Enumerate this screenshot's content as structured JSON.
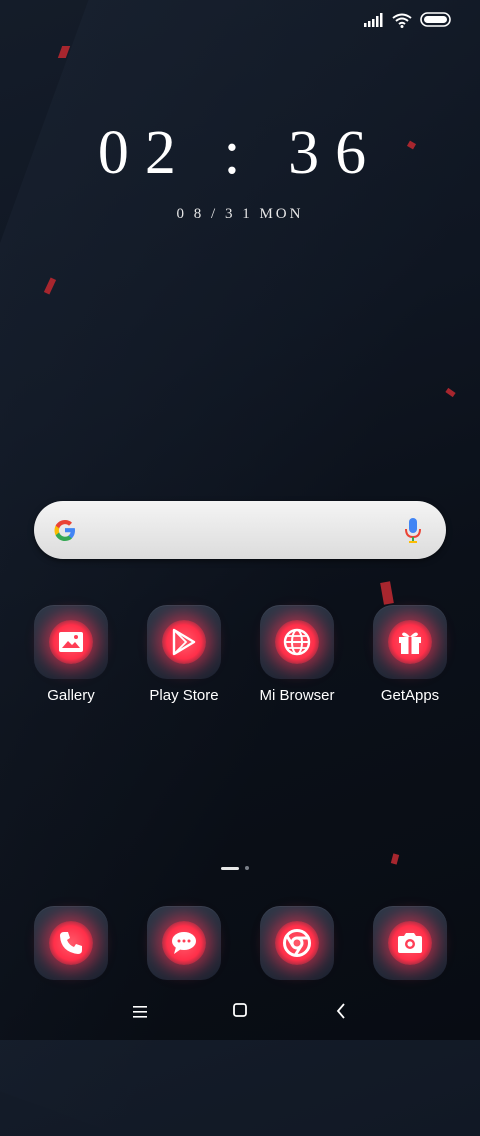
{
  "status_bar": {
    "signal_icon": "signal-bars-icon",
    "wifi_icon": "wifi-icon",
    "battery_icon": "battery-icon"
  },
  "lockclock": {
    "time": "02 : 36",
    "date": "0 8 / 3 1  MON"
  },
  "search_widget": {
    "logo_icon": "google-g-icon",
    "mic_icon": "microphone-icon"
  },
  "apps": [
    {
      "label": "Gallery",
      "icon": "image-icon"
    },
    {
      "label": "Play Store",
      "icon": "play-store-icon"
    },
    {
      "label": "Mi Browser",
      "icon": "globe-icon"
    },
    {
      "label": "GetApps",
      "icon": "gift-icon"
    }
  ],
  "page_indicator": {
    "pages": 2,
    "current": 1
  },
  "dock": [
    {
      "icon": "phone-icon"
    },
    {
      "icon": "message-icon"
    },
    {
      "icon": "chrome-icon"
    },
    {
      "icon": "camera-icon"
    }
  ],
  "nav_bar": {
    "menu_icon": "menu-icon",
    "home_icon": "home-square-icon",
    "back_icon": "back-chevron-icon"
  },
  "colors": {
    "background": "#0c121b",
    "accent_glow": "#ff2f49",
    "tile": "#242d3b",
    "shard": "#a7262e"
  }
}
